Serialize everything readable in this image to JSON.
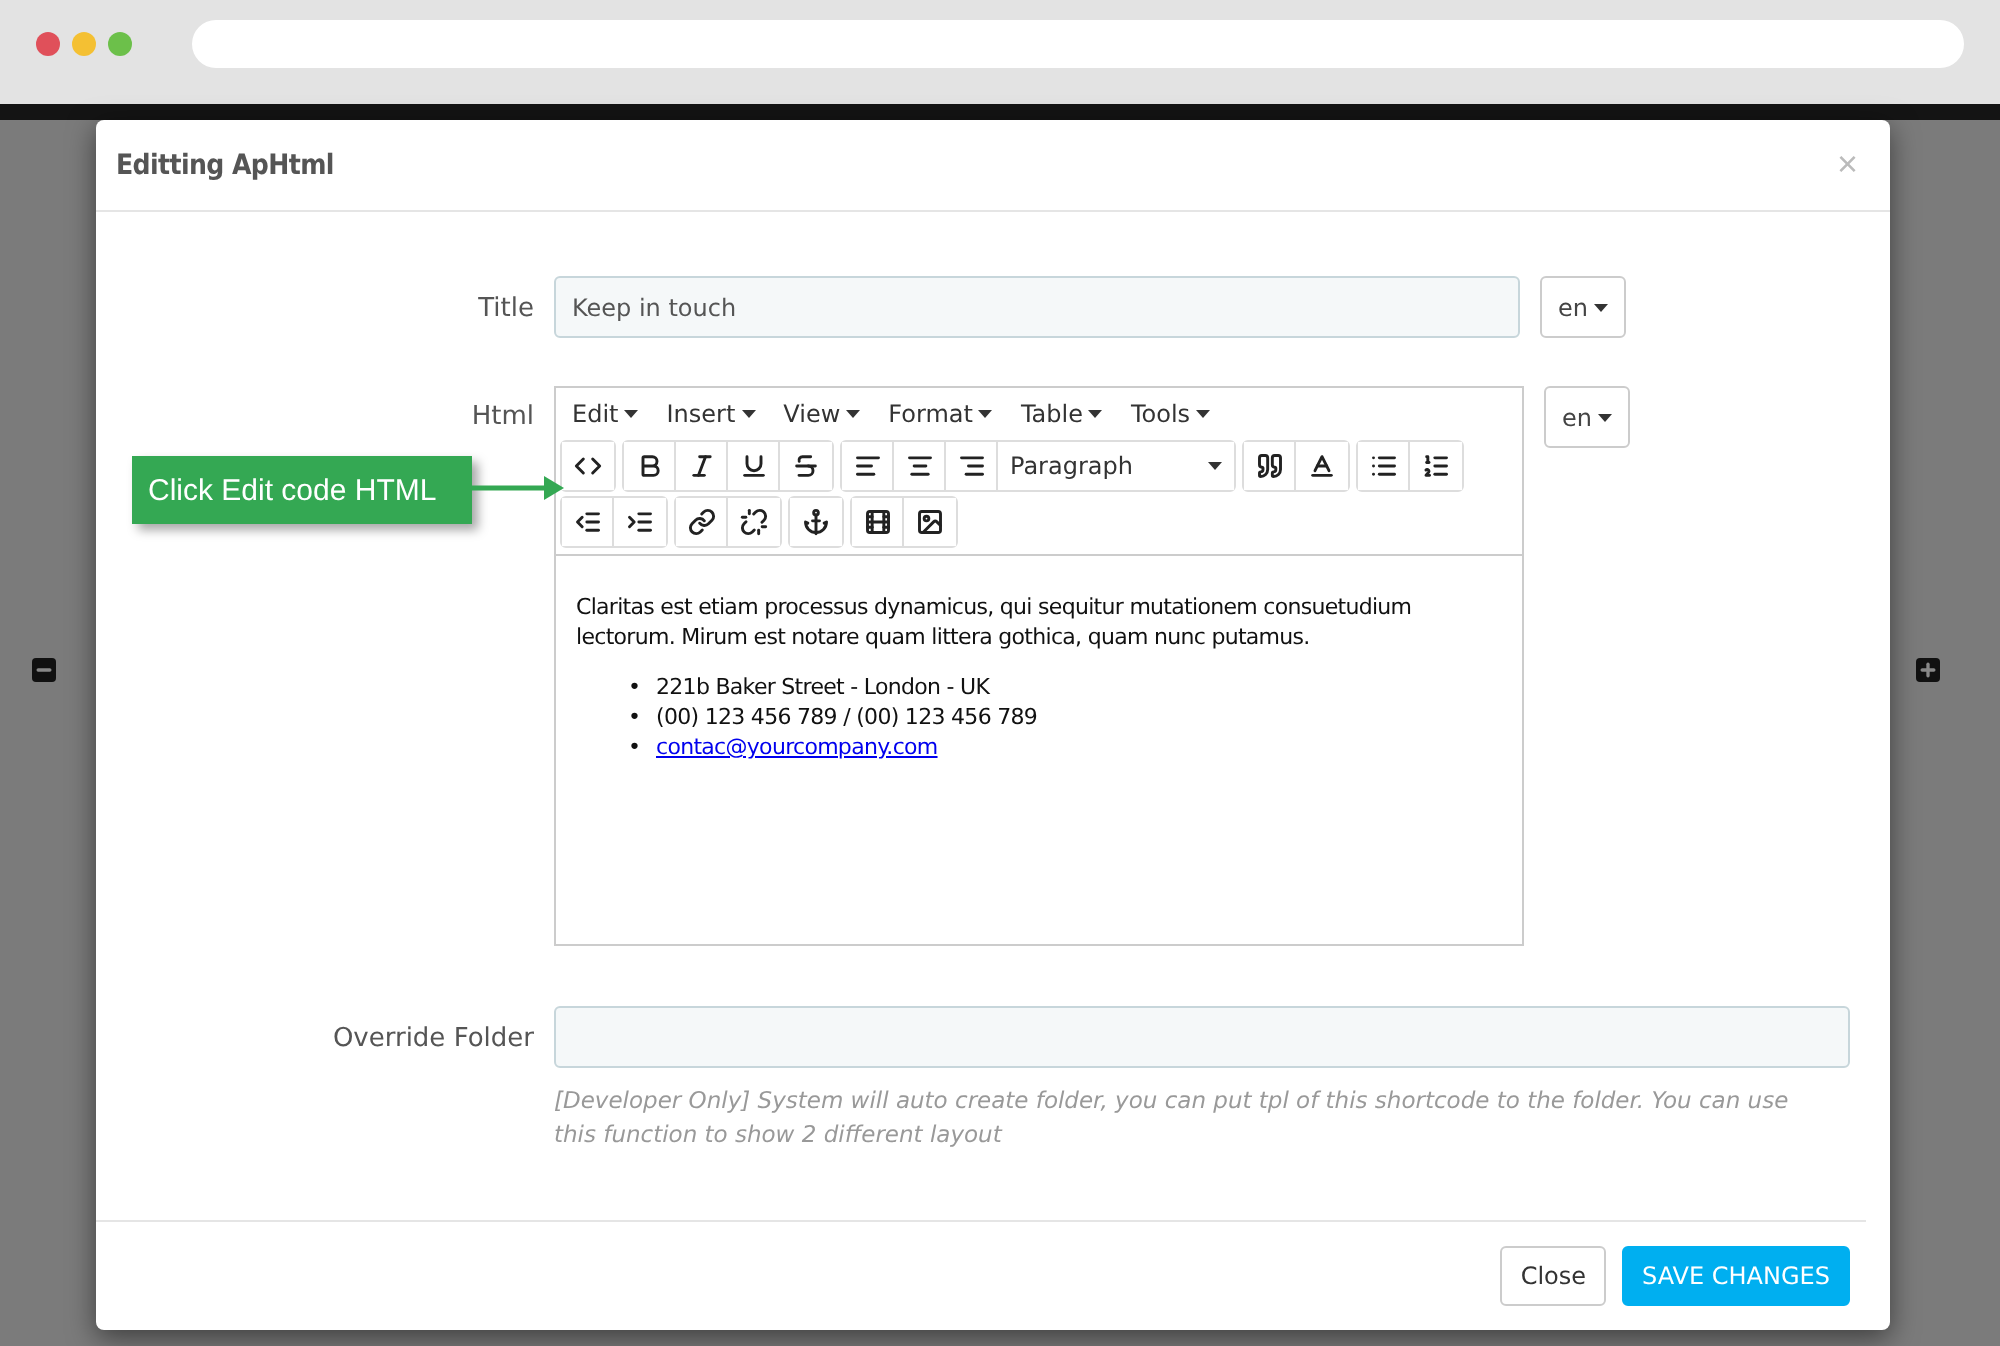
{
  "callout": "Click Edit code HTML",
  "modal": {
    "title": "Editting ApHtml",
    "close": "×"
  },
  "fields": [
    {
      "label": "Title",
      "value": "Keep in touch",
      "language": "en"
    }
  ],
  "editor": {
    "label": "Html",
    "language": "en",
    "menus": [
      "Edit",
      "Insert",
      "View",
      "Format",
      "Table",
      "Tools"
    ],
    "block_format": "Paragraph",
    "paragraph": "Claritas est etiam processus dynamicus, qui sequitur mutationem consuetudium lectorum. Mirum est notare quam littera gothica, quam nunc putamus.",
    "list": [
      {
        "kind": "text",
        "bullet": "•",
        "text": "221b Baker Street - London - UK"
      },
      {
        "kind": "text",
        "bullet": "•",
        "text": "(00) 123 456 789 / (00) 123 456 789"
      },
      {
        "kind": "link",
        "bullet": "•",
        "text": "contac@yourcompany.com"
      }
    ]
  },
  "override": {
    "label": "Override Folder",
    "help": "[Developer Only] System will auto create folder, you can put tpl of this shortcode to the folder. You can use this function to show 2 different layout"
  },
  "buttons": [
    {
      "kind": "default",
      "label": "Close"
    },
    {
      "kind": "primary",
      "label": "SAVE CHANGES"
    }
  ]
}
